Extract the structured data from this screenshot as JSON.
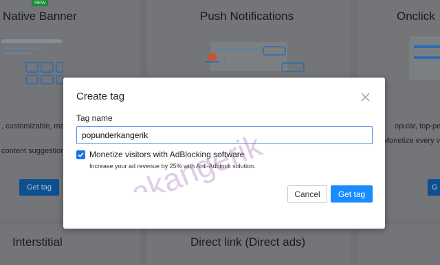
{
  "background": {
    "cards": [
      {
        "title": "Native Banner",
        "badge": "NEW"
      },
      {
        "title": "Push Notifications"
      },
      {
        "title": "Onclick"
      },
      {
        "title": "Interstitial"
      },
      {
        "title": "Direct link (Direct ads)"
      }
    ],
    "snippets": [
      ", customizable, mat",
      "content suggestion",
      "opular, top-perfo",
      "Monetize every vi"
    ],
    "get_tag_label": "Get tag",
    "get_tag_partial": "G"
  },
  "modal": {
    "title": "Create tag",
    "field_label": "Tag name",
    "input_value": "popunderkangerik",
    "checkbox_checked": true,
    "checkbox_label": "Monetize visitors with AdBlocking software",
    "checkbox_sub": "Increase your ad revenue by 25% with Anti-Adblock solution.",
    "cancel_label": "Cancel",
    "get_tag_label": "Get tag"
  },
  "watermark": "akangerik",
  "colors": {
    "accent": "#1a8cff",
    "checkbox": "#1a73e8",
    "input_border": "#4a90e2",
    "badge_green": "#1e8a3e",
    "overlay_button": "#0d4f8f"
  }
}
